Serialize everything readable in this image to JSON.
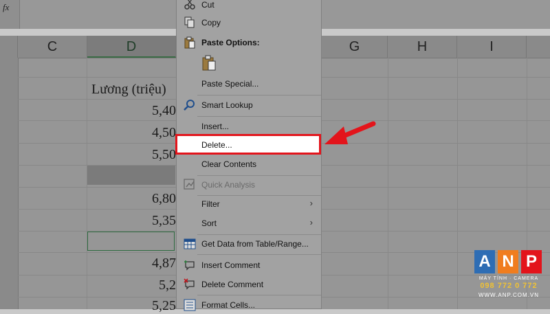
{
  "formula_bar": {
    "fx_label": "fx"
  },
  "columns": [
    {
      "label": "C"
    },
    {
      "label": "D"
    },
    {
      "label": "G"
    },
    {
      "label": "H"
    },
    {
      "label": "I"
    }
  ],
  "cells": {
    "header_text": "Lương (triệu)",
    "values": [
      "5,40",
      "4,50",
      "5,50",
      "6,80",
      "5,35",
      "4,87",
      "5,2",
      "5,25"
    ]
  },
  "context_menu": {
    "cut": "Cut",
    "copy": "Copy",
    "paste_options": "Paste Options:",
    "paste_special": "Paste Special...",
    "smart_lookup": "Smart Lookup",
    "insert": "Insert...",
    "delete": "Delete...",
    "clear_contents": "Clear Contents",
    "quick_analysis": "Quick Analysis",
    "filter": "Filter",
    "sort": "Sort",
    "get_data": "Get Data from Table/Range...",
    "insert_comment": "Insert Comment",
    "delete_comment": "Delete Comment",
    "format_cells": "Format Cells..."
  },
  "watermark": {
    "letters": [
      "A",
      "N",
      "P"
    ],
    "tagline": "MÁY TÍNH · CAMERA",
    "phone": "098 772 0 772",
    "website": "WWW.ANP.COM.VN",
    "colors": [
      "#2e6db4",
      "#f07d1f",
      "#e3141b"
    ]
  },
  "colors": {
    "highlight_border": "#e3141b",
    "arrow": "#e3141b",
    "active_cell_border": "#2e6b40"
  }
}
